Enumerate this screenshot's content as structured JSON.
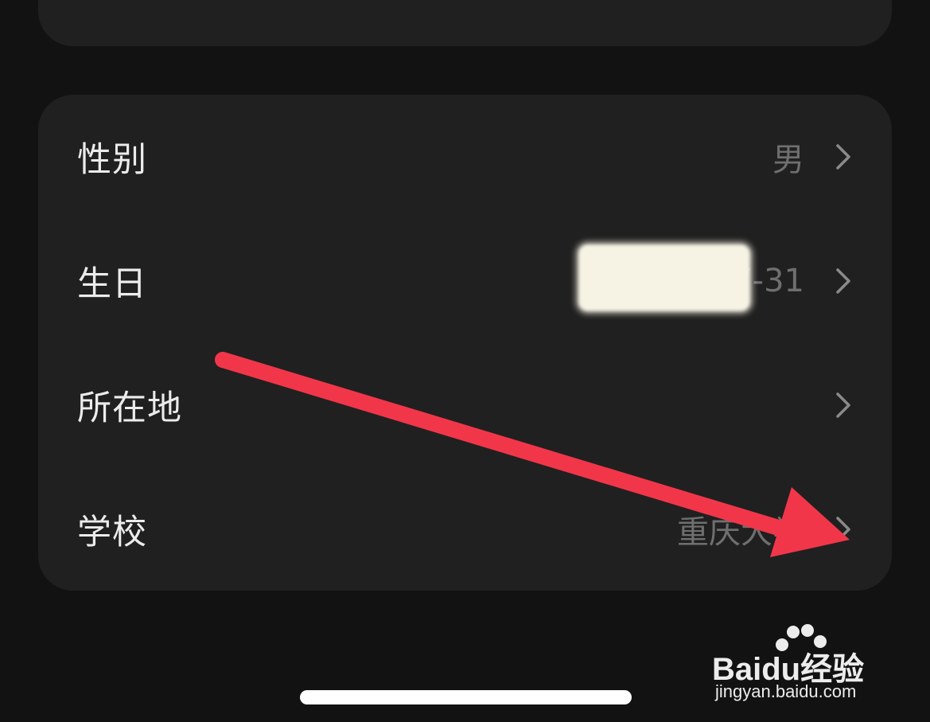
{
  "profile": {
    "rows": [
      {
        "label": "性别",
        "value": "男"
      },
      {
        "label": "生日",
        "value": "1985-07-31"
      },
      {
        "label": "所在地",
        "value": ""
      },
      {
        "label": "学校",
        "value": "重庆大学"
      }
    ]
  },
  "icons": {
    "chevron": "chevron-right-icon",
    "arrow": "red-arrow-annotation"
  },
  "colors": {
    "background": "#121212",
    "card": "#202020",
    "label": "#ececec",
    "value": "#6f6f6f",
    "chevron": "#8a8a8a",
    "arrow": "#f2364a",
    "home_indicator": "#ffffff"
  },
  "watermark": {
    "logo_text": "Baidu经验",
    "url": "jingyan.baidu.com"
  }
}
